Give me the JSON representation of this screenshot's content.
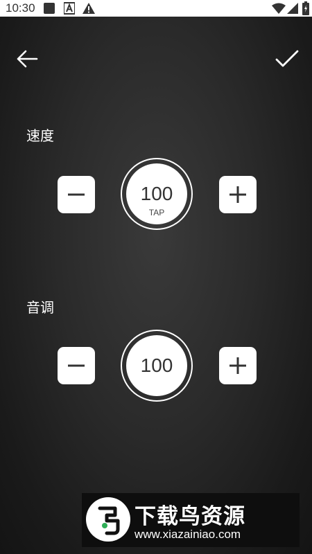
{
  "status_bar": {
    "time": "10:30",
    "icons": [
      "square-notification-icon",
      "text-a-notification-icon",
      "warning-icon",
      "wifi-icon",
      "cellular-signal-icon",
      "battery-charging-icon"
    ]
  },
  "app_bar": {
    "back_icon": "arrow-left-icon",
    "confirm_icon": "check-icon"
  },
  "speed": {
    "label": "速度",
    "value": "100",
    "sublabel": "TAP",
    "decrease_icon": "minus-icon",
    "increase_icon": "plus-icon"
  },
  "pitch": {
    "label": "音调",
    "value": "100",
    "decrease_icon": "minus-icon",
    "increase_icon": "plus-icon"
  },
  "watermark": {
    "title": "下载鸟资源",
    "url": "www.xiazainiao.com"
  },
  "colors": {
    "background_center": "#3a3a3a",
    "background_edge": "#141414",
    "button_fill": "#ffffff",
    "icon_dark": "#333333"
  }
}
